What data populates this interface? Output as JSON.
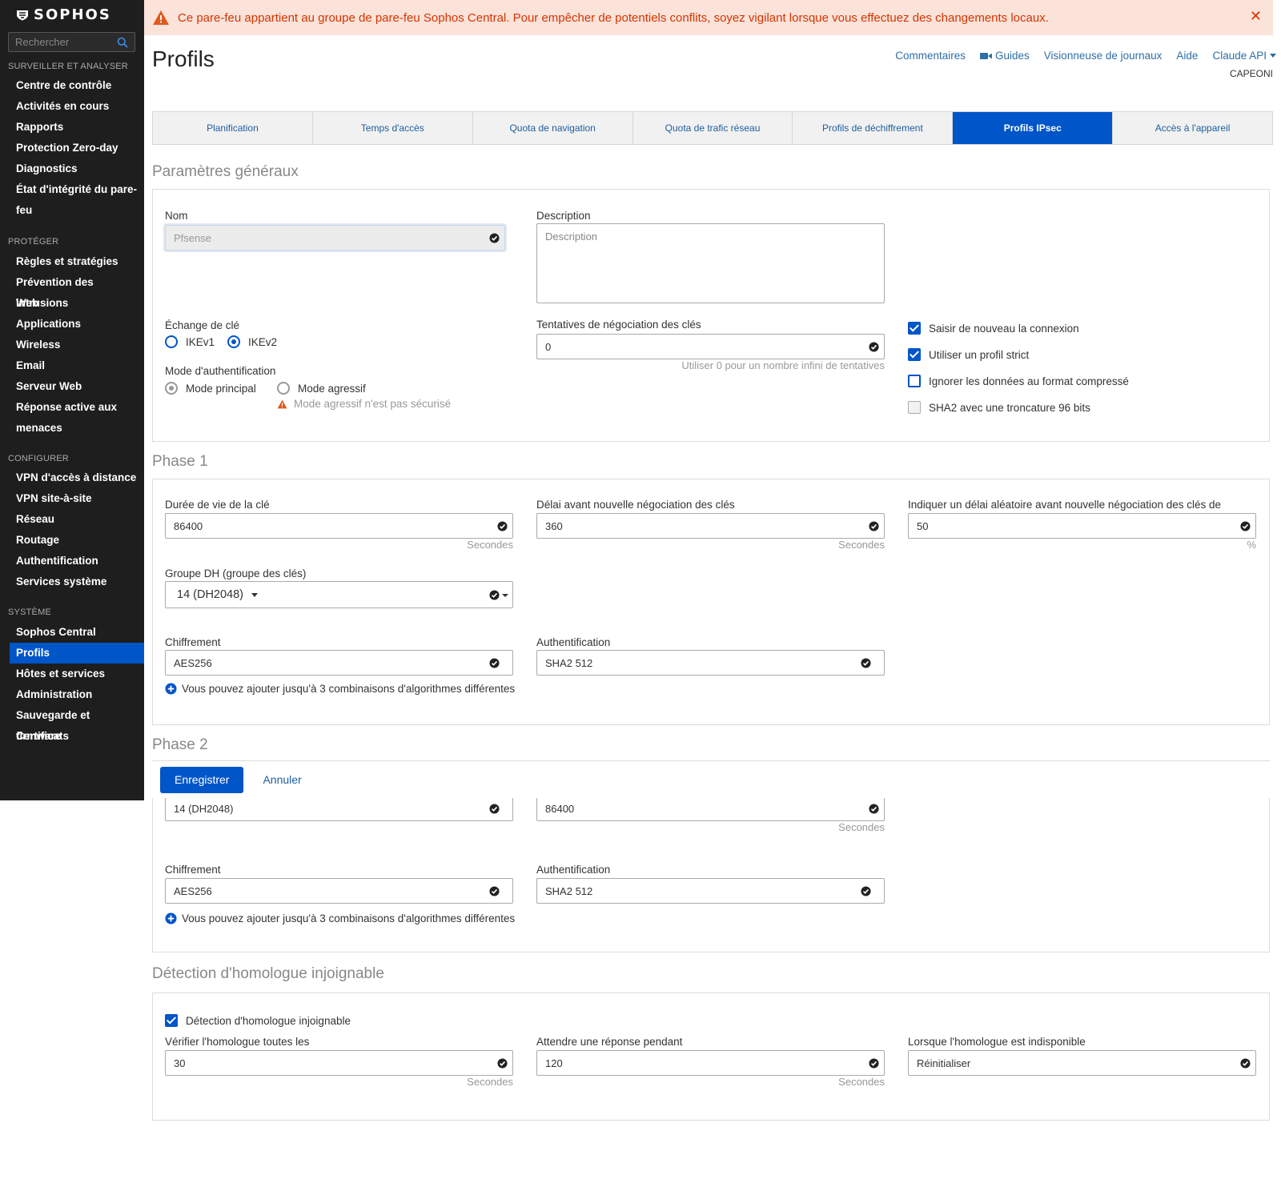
{
  "brand": {
    "name": "SOPHOS"
  },
  "search": {
    "placeholder": "Rechercher"
  },
  "sidebar": {
    "sections": [
      {
        "title": "SURVEILLER ET ANALYSER",
        "items": [
          "Centre de contrôle",
          "Activités en cours",
          "Rapports",
          "Protection Zero-day",
          "Diagnostics",
          "État d'intégrité du pare-",
          "feu"
        ]
      },
      {
        "title": "PROTÉGER",
        "items": [
          "Règles et stratégies",
          "Prévention des intrusions",
          "Web",
          "Applications",
          "Wireless",
          "Email",
          "Serveur Web",
          "Réponse active aux",
          "menaces"
        ]
      },
      {
        "title": "CONFIGURER",
        "items": [
          "VPN d'accès à distance",
          "VPN site-à-site",
          "Réseau",
          "Routage",
          "Authentification",
          "Services système"
        ]
      },
      {
        "title": "SYSTÈME",
        "items": [
          "Sophos Central",
          "Profils",
          "Hôtes et services",
          "Administration",
          "Sauvegarde et firmware",
          "Certificats"
        ]
      }
    ],
    "active": "Profils"
  },
  "alert": {
    "text": "Ce pare-feu appartient au groupe de pare-feu Sophos Central. Pour empêcher de potentiels conflits, soyez vigilant lorsque vous effectuez des changements locaux.",
    "color": "#d73300"
  },
  "header": {
    "title": "Profils",
    "links": [
      "Commentaires",
      "Guides",
      "Visionneuse de journaux",
      "Aide",
      "Claude API"
    ],
    "subtitle": "CAPEONI"
  },
  "tabs": [
    "Planification",
    "Temps d'accès",
    "Quota de navigation",
    "Quota de trafic réseau",
    "Profils de déchiffrement",
    "Profils IPsec",
    "Accès à l'appareil"
  ],
  "active_tab": "Profils IPsec",
  "general": {
    "heading": "Paramètres généraux",
    "name_label": "Nom",
    "name_value": "Pfsense",
    "description_label": "Description",
    "description_placeholder": "Description",
    "key_exchange_label": "Échange de clé",
    "ikev1": "IKEv1",
    "ikev2": "IKEv2",
    "key_exchange_selected": "IKEv2",
    "auth_mode_label": "Mode d'authentification",
    "main_mode": "Mode principal",
    "aggressive_mode": "Mode agressif",
    "auth_mode_selected": "Mode principal",
    "aggressive_warning": "Mode agressif n'est pas sécurisé",
    "rekey_attempts_label": "Tentatives de négociation des clés",
    "rekey_attempts_value": "0",
    "rekey_attempts_hint": "Utiliser 0 pour un nombre infini de tentatives",
    "checks": [
      {
        "label": "Saisir de nouveau la connexion",
        "state": "checked"
      },
      {
        "label": "Utiliser un profil strict",
        "state": "checked"
      },
      {
        "label": "Ignorer les données au format compressé",
        "state": "unchecked"
      },
      {
        "label": "SHA2 avec une troncature 96 bits",
        "state": "disabled"
      }
    ]
  },
  "phase1": {
    "heading": "Phase 1",
    "key_life_label": "Durée de vie de la clé",
    "key_life_value": "86400",
    "key_life_unit": "Secondes",
    "rekey_margin_label": "Délai avant nouvelle négociation des clés",
    "rekey_margin_value": "360",
    "rekey_margin_unit": "Secondes",
    "random_label": "Indiquer un délai aléatoire avant nouvelle négociation des clés de",
    "random_value": "50",
    "random_unit": "%",
    "dh_label": "Groupe DH (groupe des clés)",
    "dh_value": "14 (DH2048)",
    "enc_label": "Chiffrement",
    "enc_value": "AES256",
    "auth_label": "Authentification",
    "auth_value": "SHA2 512",
    "add_text": "Vous pouvez ajouter jusqu'à 3 combinaisons d'algorithmes différentes"
  },
  "phase2": {
    "heading": "Phase 2",
    "pfs_value": "14 (DH2048)",
    "key_life_value": "86400",
    "key_life_unit": "Secondes",
    "enc_label": "Chiffrement",
    "enc_value": "AES256",
    "auth_label": "Authentification",
    "auth_value": "SHA2 512",
    "add_text": "Vous pouvez ajouter jusqu'à 3 combinaisons d'algorithmes différentes"
  },
  "buttons": {
    "save": "Enregistrer",
    "cancel": "Annuler"
  },
  "dpd": {
    "heading": "Détection d'homologue injoignable",
    "enable_label": "Détection d'homologue injoignable",
    "check_label": "Vérifier l'homologue toutes les",
    "check_value": "30",
    "check_unit": "Secondes",
    "wait_label": "Attendre une réponse pendant",
    "wait_value": "120",
    "wait_unit": "Secondes",
    "unavailable_label": "Lorsque l'homologue est indisponible",
    "unavailable_value": "Réinitialiser"
  },
  "colors": {
    "accent": "#0055c8",
    "sidebar": "#1e1e1e",
    "alert_bg": "#fbe3d9",
    "link": "#1f5d9e"
  }
}
